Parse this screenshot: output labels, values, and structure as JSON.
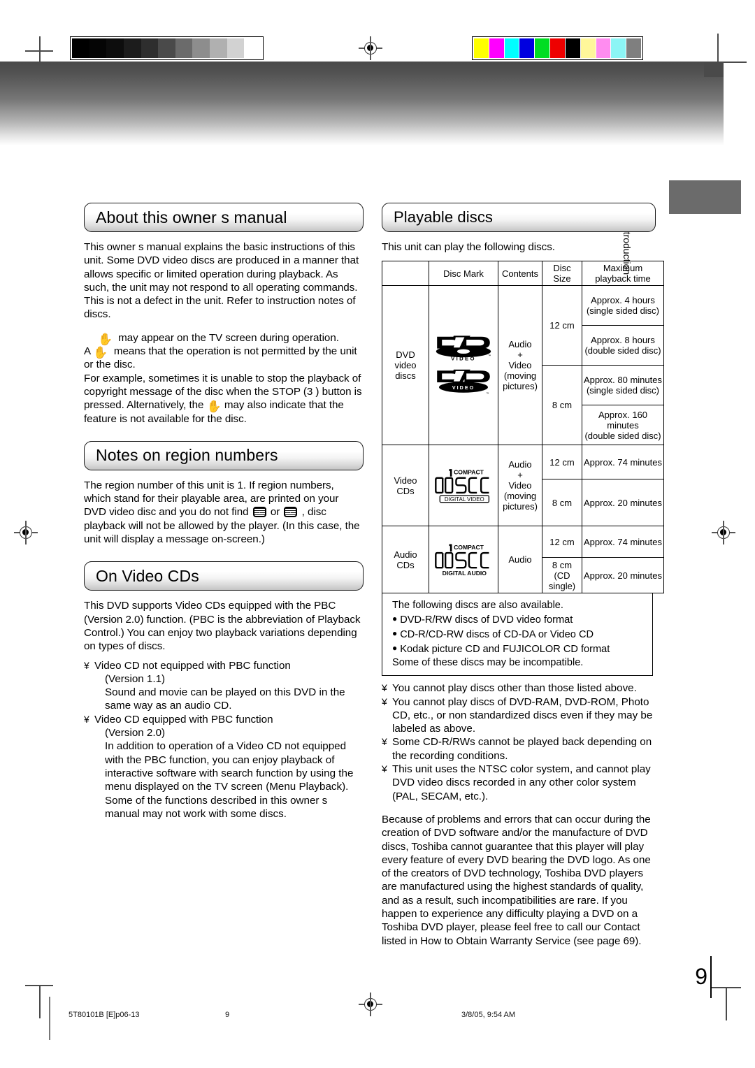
{
  "print_marks": {
    "grayscale_steps": [
      "#000000",
      "#050505",
      "#0d0d0d",
      "#1c1c1c",
      "#2e2e2e",
      "#4a4a4a",
      "#6b6b6b",
      "#8d8d8d",
      "#b0b0b0",
      "#d2d2d2",
      "#ffffff"
    ],
    "color_steps": [
      "#ffff00",
      "#ff00ff",
      "#00ffff",
      "#0000e0",
      "#00dd22",
      "#ee0000",
      "#000000",
      "#fff79a",
      "#ff8cf0",
      "#8cf5f5",
      "#7f7f7f"
    ]
  },
  "side_tab": {
    "label": "Introduction"
  },
  "left_column": {
    "section1": {
      "title": "About this owner s manual",
      "paragraph1": "This owner s manual explains the basic instructions of this unit. Some DVD video discs are produced in a manner that allows specific or limited operation during playback. As such, the unit may not respond to all operating commands. This is not a defect in the unit. Refer to instruction notes of discs.",
      "line_hand1_after": "may appear on the TV screen during operation.",
      "line_hand2_before": "A",
      "line_hand2_after": "means that the operation is not permitted by the unit or the disc.",
      "paragraph2_part1": "For example, sometimes it is unable to stop the playback of copyright message of the disc when the STOP (3 ) button is pressed. Alternatively, the",
      "paragraph2_part2": "may also indicate that the feature is not available for the disc."
    },
    "section2": {
      "title": "Notes on region numbers",
      "text_part1": "The region number of this unit is 1. If region numbers, which stand for their playable area, are printed on your DVD video disc and you do not find",
      "text_or": "or",
      "text_part2": ", disc playback will not be allowed by the player. (In this case, the unit will display a message on-screen.)"
    },
    "section3": {
      "title": "On Video CDs",
      "paragraph1": "This DVD supports Video CDs equipped with the PBC (Version 2.0) function. (PBC is the abbreviation of Playback Control.) You can enjoy two playback variations depending on types of discs.",
      "bullets": [
        {
          "marker": "¥",
          "heading": "Video CD not equipped with PBC function",
          "sub1": "(Version 1.1)",
          "sub2": "Sound and movie can be played on this DVD in the same way as an audio CD."
        },
        {
          "marker": "¥",
          "heading": "Video CD equipped with PBC function",
          "sub1": "(Version 2.0)",
          "sub2": "In addition to operation of a Video CD not equipped with the PBC function, you can enjoy playback of interactive software with search function by using the menu displayed on the TV screen (Menu Playback). Some of the functions described in this owner s manual may not work with some discs."
        }
      ]
    }
  },
  "right_column": {
    "section_title": "Playable discs",
    "intro": "This unit can play the following discs.",
    "table": {
      "headers": [
        "",
        "Disc Mark",
        "Contents",
        "Disc Size",
        "Maximum playback time"
      ],
      "header_parts": {
        "col4_line1": "Disc",
        "col4_line2": "Size",
        "col5_line1": "Maximum",
        "col5_line2": "playback time"
      },
      "rows": [
        {
          "type": "DVD video discs",
          "type_lines": [
            "DVD",
            "video",
            "discs"
          ],
          "marks": [
            "DVD VIDEO",
            "DVD VIDEO"
          ],
          "contents_lines": [
            "Audio",
            "+",
            "Video",
            "(moving",
            "pictures)"
          ],
          "sizes": [
            {
              "size": "12 cm",
              "times": [
                "Approx. 4 hours (single sided disc)",
                "Approx. 8 hours (double sided disc)"
              ],
              "times_split": [
                [
                  "Approx. 4 hours",
                  "(single sided disc)"
                ],
                [
                  "Approx. 8 hours",
                  "(double sided disc)"
                ]
              ]
            },
            {
              "size": "8 cm",
              "times": [
                "Approx. 80 minutes (single sided disc)",
                "Approx. 160 minutes (double sided disc)"
              ],
              "times_split": [
                [
                  "Approx. 80 minutes",
                  "(single sided disc)"
                ],
                [
                  "Approx. 160 minutes",
                  "(double sided disc)"
                ]
              ]
            }
          ]
        },
        {
          "type": "Video CDs",
          "type_lines": [
            "Video",
            "CDs"
          ],
          "mark_logo": {
            "top": "COMPACT",
            "mid": "disc",
            "bottom": "DIGITAL VIDEO"
          },
          "contents_lines": [
            "Audio",
            "+",
            "Video",
            "(moving",
            "pictures)"
          ],
          "sizes": [
            {
              "size": "12 cm",
              "time": "Approx. 74 minutes"
            },
            {
              "size": "8 cm",
              "time": "Approx. 20 minutes"
            }
          ]
        },
        {
          "type": "Audio CDs",
          "type_lines": [
            "Audio",
            "CDs"
          ],
          "mark_logo": {
            "top": "COMPACT",
            "mid": "disc",
            "bottom": "DIGITAL AUDIO"
          },
          "contents_lines": [
            "Audio"
          ],
          "sizes": [
            {
              "size": "12 cm",
              "time": "Approx. 74 minutes"
            },
            {
              "size_lines": [
                "8 cm",
                "(CD",
                "single)"
              ],
              "time": "Approx. 20 minutes"
            }
          ]
        }
      ]
    },
    "note_box": {
      "intro": "The following discs are also available.",
      "bullets": [
        "DVD-R/RW discs of DVD video format",
        "CD-R/CD-RW discs of CD-DA or Video CD",
        "Kodak picture CD and FUJICOLOR CD format"
      ],
      "outro": "Some of these discs may be incompatible."
    },
    "warnings": [
      {
        "marker": "¥",
        "text": "You cannot play discs other than those listed above."
      },
      {
        "marker": "¥",
        "text": "You cannot play discs of DVD-RAM, DVD-ROM, Photo CD, etc., or non standardized discs even if they may be labeled as above."
      },
      {
        "marker": "¥",
        "text": "Some CD-R/RWs cannot be played back depending on the recording conditions."
      },
      {
        "marker": "¥",
        "text": "This unit uses the NTSC color system, and cannot play DVD video discs recorded in any other color system (PAL, SECAM, etc.)."
      }
    ],
    "closing_paragraph": "Because of problems and errors that can occur during the creation of DVD software and/or the manufacture of DVD discs, Toshiba cannot guarantee that this player will play every feature of every DVD bearing the DVD logo.  As one of the creators of DVD technology, Toshiba DVD players are manufactured using the highest standards of quality, and as a result, such incompatibilities are rare.  If you happen to experience any difficulty playing a DVD on a Toshiba DVD player, please feel free to call our Contact listed in  How to Obtain Warranty Service  (see page 69)."
  },
  "page_number": "9",
  "footer": {
    "file_id": "5T80101B [E]p06-13",
    "page": "9",
    "timestamp": "3/8/05, 9:54 AM"
  }
}
